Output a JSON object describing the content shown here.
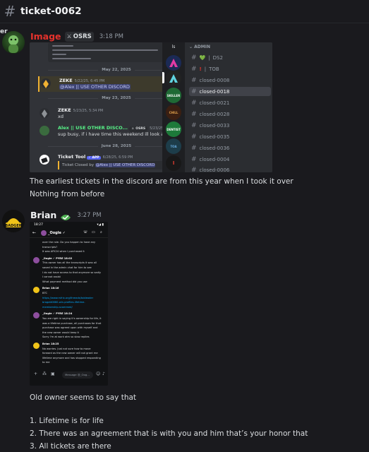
{
  "header": {
    "channel_title": "ticket-0062"
  },
  "sidebar_stub": "er",
  "message1": {
    "author": "Image",
    "tag": "OSRS",
    "time": "3:18 PM",
    "embedded": {
      "dates": [
        "May 22, 2025",
        "May 23, 2025",
        "June 28, 2025"
      ],
      "messages": [
        {
          "name": "ZEKE",
          "time": "5/22/25, 6:45 PM",
          "mention": "@Alex || USE OTHER DISCORD",
          "text": ""
        },
        {
          "name": "ZEKE",
          "time": "5/23/25, 5:34 PM",
          "mention": "",
          "text": "xd"
        },
        {
          "name": "Alex || USE OTHER DISCO...",
          "tag": "OSRS",
          "time": "5/23/25, 10:14 PM",
          "mention": "",
          "text": "sup busy, if i have time this weekend ill look at it."
        },
        {
          "name": "Ticket Tool",
          "app": "APP",
          "time": "6/28/25, 6:59 PM",
          "closed_prefix": "Ticket Closed by",
          "mention": "@Alex || USE OTHER DISCORD"
        }
      ],
      "server_label": "ls",
      "category": "ADMIN",
      "channels": [
        "DS2",
        "TOB",
        "closed-0008",
        "closed-0018",
        "closed-0021",
        "closed-0028",
        "closed-0033",
        "closed-0035",
        "closed-0036",
        "closed-0004",
        "closed-0006"
      ],
      "active_channel": "closed-0018"
    },
    "text_lines": [
      "The earliest tickets in the discord are from this year when I took it over",
      "Nothing from before"
    ]
  },
  "message2": {
    "author": "Brian",
    "time": "3:27 PM",
    "phone": {
      "status_time": "18:27",
      "status_right": "▾◢ ▮",
      "contact": "_Oogle",
      "input_placeholder": "Message @_Oog...",
      "lines": [
        {
          "t": "over the role. Do you happen to have any",
          "s": ""
        },
        {
          "t": "transcripts?",
          "s": ""
        },
        {
          "t": "It was AFK24 when I purchased it",
          "s": ""
        },
        {
          "t": "_Oogle ✓ PYRE  18:02",
          "s": "bold"
        },
        {
          "t": "This owner has all the transcripts it was all",
          "s": ""
        },
        {
          "t": "saved in the admin chat for him to see",
          "s": ""
        },
        {
          "t": "I do not have access to that anymore so sadly",
          "s": ""
        },
        {
          "t": "I cannot assist",
          "s": ""
        },
        {
          "t": "What payment method did you use",
          "s": ""
        },
        {
          "t": "Brian  18:16",
          "s": "bold"
        },
        {
          "t": "BTC",
          "s": ""
        },
        {
          "t": "https://www.rsfrix.org/threads/tobleader",
          "s": "link"
        },
        {
          "t": "bragatt0660-win-profiles-lifetime-",
          "s": "link"
        },
        {
          "t": "membership-scammed/",
          "s": "link"
        },
        {
          "t": "_Oogle ✓ PYRE  18:24",
          "s": "bold"
        },
        {
          "t": "You are right in saying it's ownership for life, it",
          "s": ""
        },
        {
          "t": "was a lifetime purchase, all purchases for that",
          "s": ""
        },
        {
          "t": "purchase was agreed upon with myself and",
          "s": ""
        },
        {
          "t": "the new owner would keep it",
          "s": ""
        },
        {
          "t": "Sorry I'm at work atm so slow replies",
          "s": ""
        },
        {
          "t": "Brian  18:25",
          "s": "bold"
        },
        {
          "t": "No worries. Just not sure how to move",
          "s": ""
        },
        {
          "t": "forward as the new owner will not grant me",
          "s": ""
        },
        {
          "t": "lifetime anymore and has stopped responding",
          "s": ""
        },
        {
          "t": "to me",
          "s": ""
        }
      ]
    },
    "text_lines": [
      "Old owner seems to say that",
      "1. Lifetime is for life",
      "2. There was an agreement that is with you and him that’s your honor that",
      "3. All tickets are there"
    ]
  },
  "colors": {
    "image_author": "#e5322c",
    "alex_name": "#57f287",
    "mention_bg": "#3c4270",
    "bg": "#1a1a1e"
  }
}
